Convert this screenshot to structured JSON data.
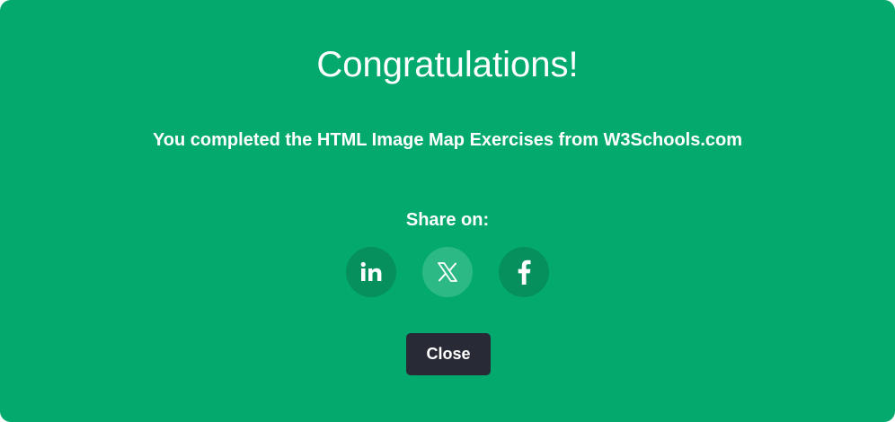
{
  "modal": {
    "title": "Congratulations!",
    "message": "You completed the HTML Image Map Exercises from W3Schools.com",
    "share_label": "Share on:",
    "close_label": "Close",
    "colors": {
      "background": "#04aa6d",
      "social_button": "#05905e",
      "social_button_hover": "#2cb985",
      "close_button": "#282a35",
      "text": "#ffffff"
    }
  },
  "social": [
    {
      "icon": "linkedin-icon",
      "glyph": "in"
    },
    {
      "icon": "x-icon",
      "glyph": "X"
    },
    {
      "icon": "facebook-icon",
      "glyph": "f"
    }
  ]
}
